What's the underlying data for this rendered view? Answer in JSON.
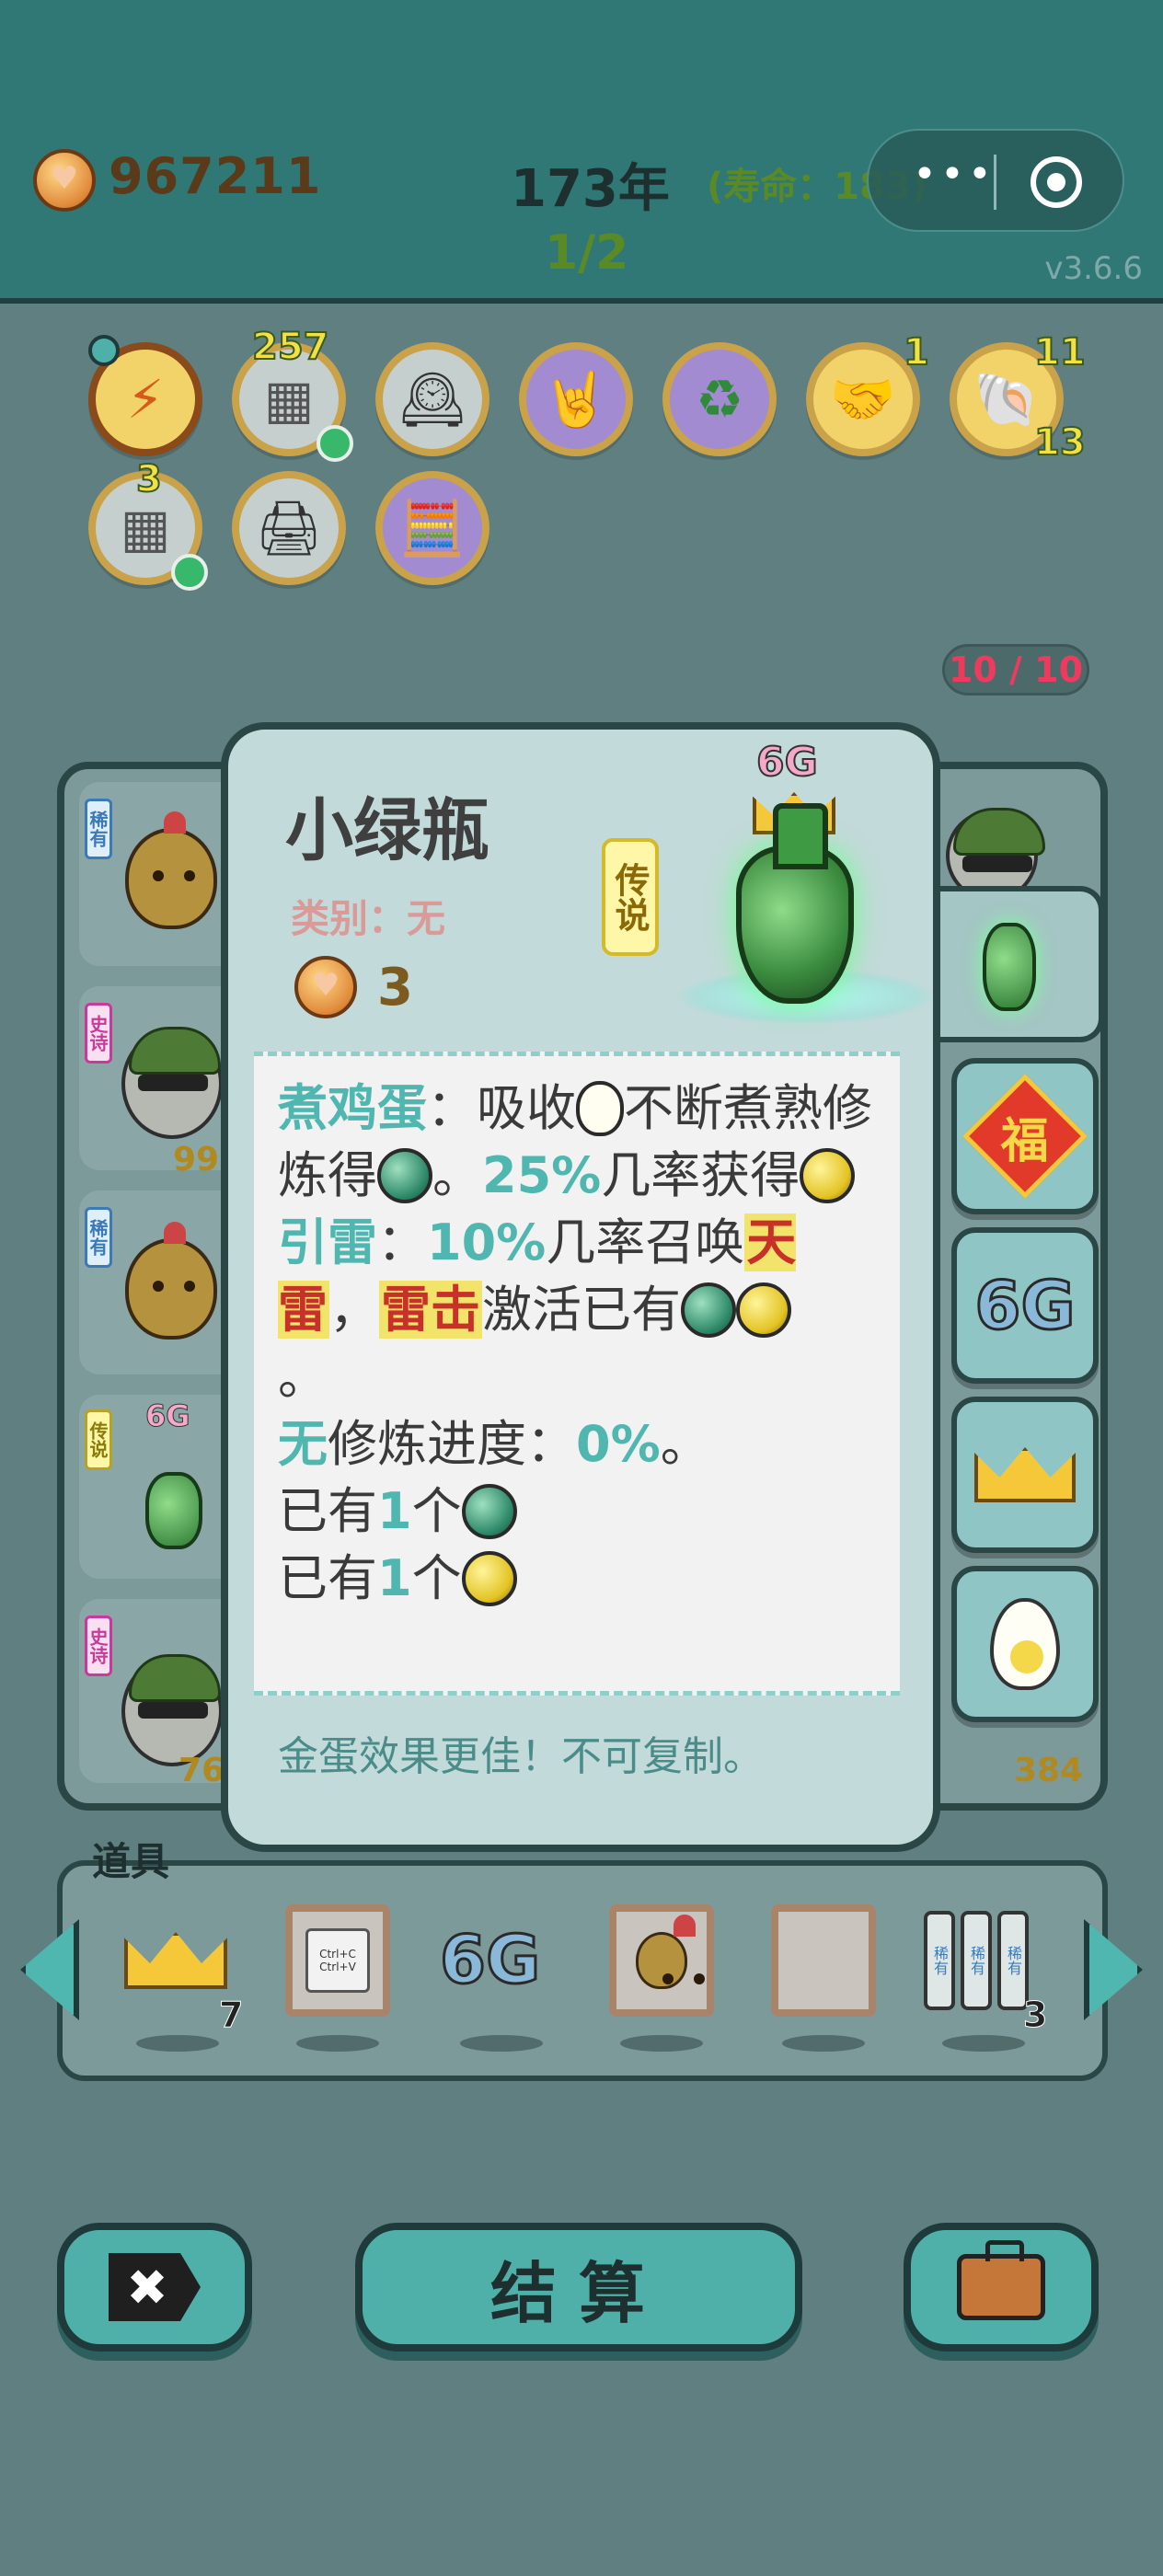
{
  "header": {
    "coins": "967211",
    "year": "173年",
    "lifespan": "(寿命：183)",
    "progress": "1/2",
    "version": "v3.6.6",
    "menu_dots": "•••"
  },
  "status_icons": [
    {
      "name": "lightning-icon",
      "glyph": "⚡",
      "badge": ""
    },
    {
      "name": "dozen-eggs-icon",
      "glyph": "▦",
      "badge": "257"
    },
    {
      "name": "time-magazine-icon",
      "glyph": "🕰",
      "badge": ""
    },
    {
      "name": "rock-hand-icon",
      "glyph": "🤘",
      "badge": ""
    },
    {
      "name": "recycle-icon",
      "glyph": "♻",
      "badge": ""
    },
    {
      "name": "handshake-icon",
      "glyph": "🤝",
      "badge": "1"
    },
    {
      "name": "shell-icon",
      "glyph": "🐚",
      "badge": "11",
      "badge2": "13"
    },
    {
      "name": "egg-tray-icon",
      "glyph": "▦",
      "badge": "3"
    },
    {
      "name": "printer-icon",
      "glyph": "🖨",
      "badge": ""
    },
    {
      "name": "math-head-icon",
      "glyph": "🧮",
      "badge": ""
    }
  ],
  "slot_counter": "10 / 10",
  "board": {
    "rarity_labels": [
      "稀有",
      "史诗",
      "稀有",
      "传说",
      "史诗"
    ],
    "numbers": [
      "99",
      "76",
      "384"
    ],
    "left_vase_g6": "6G"
  },
  "panel": {
    "title": "小绿瓶",
    "category": "类别：无",
    "rarity": "传说",
    "price": "3",
    "g6": "6G",
    "desc": {
      "skill1_name": "煮鸡蛋",
      "skill1_a": "：吸收",
      "skill1_b": "不断煮熟修炼得",
      "skill1_c": "。",
      "skill1_pct": "25%",
      "skill1_d": "几率获得",
      "skill2_name": "引雷",
      "skill2_a": "：",
      "skill2_pct": "10%",
      "skill2_b": "几率召唤",
      "skill2_hl1": "天雷",
      "skill2_c": "，",
      "skill2_hl2": "雷击",
      "skill2_d": "激活已有",
      "period": "。",
      "progress_kw": "无",
      "progress_text": "修炼进度：",
      "progress_pct": "0%",
      "progress_end": "。",
      "have1_a": "已有",
      "have1_n": "1",
      "have1_b": "个",
      "have2_a": "已有",
      "have2_n": "1",
      "have2_b": "个"
    },
    "footer": "金蛋效果更佳！不可复制。"
  },
  "side_tabs": {
    "fu": "福",
    "g6": "6G"
  },
  "items": {
    "label": "道具",
    "crown_count": "7",
    "copy_paste": "Ctrl+C\nCtrl+V",
    "g6": "6G",
    "books_count": "3",
    "book_label": "稀有"
  },
  "buttons": {
    "settle": "结算",
    "close": "✖"
  },
  "colors": {
    "header_bg": "#2f7876",
    "accent_teal": "#4fb7b0",
    "gold_badge": "#f2e142",
    "counter_red": "#ef3a5f"
  }
}
